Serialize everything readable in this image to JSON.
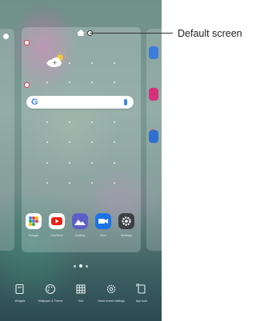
{
  "callout": {
    "label": "Default screen"
  },
  "dock": [
    {
      "name": "Google",
      "icon": "google-folder-icon"
    },
    {
      "name": "YouTube",
      "icon": "youtube-icon",
      "color": "#e62117"
    },
    {
      "name": "Gallery",
      "icon": "gallery-icon",
      "color": "#5d5fc7"
    },
    {
      "name": "Duo",
      "icon": "duo-icon",
      "color": "#1a73e8"
    },
    {
      "name": "Settings",
      "icon": "gear-icon",
      "color": "#3c4043"
    }
  ],
  "toolbar": [
    {
      "label": "Widgets",
      "icon": "widgets-icon"
    },
    {
      "label": "Wallpaper & Theme",
      "icon": "palette-icon"
    },
    {
      "label": "Grid",
      "icon": "grid-icon"
    },
    {
      "label": "Home screen settings",
      "icon": "gear-outline-icon"
    },
    {
      "label": "App scan",
      "icon": "app-scan-icon"
    }
  ],
  "colors": {
    "remove_badge": "#e23c4a",
    "search_accent": "#4285f4"
  }
}
